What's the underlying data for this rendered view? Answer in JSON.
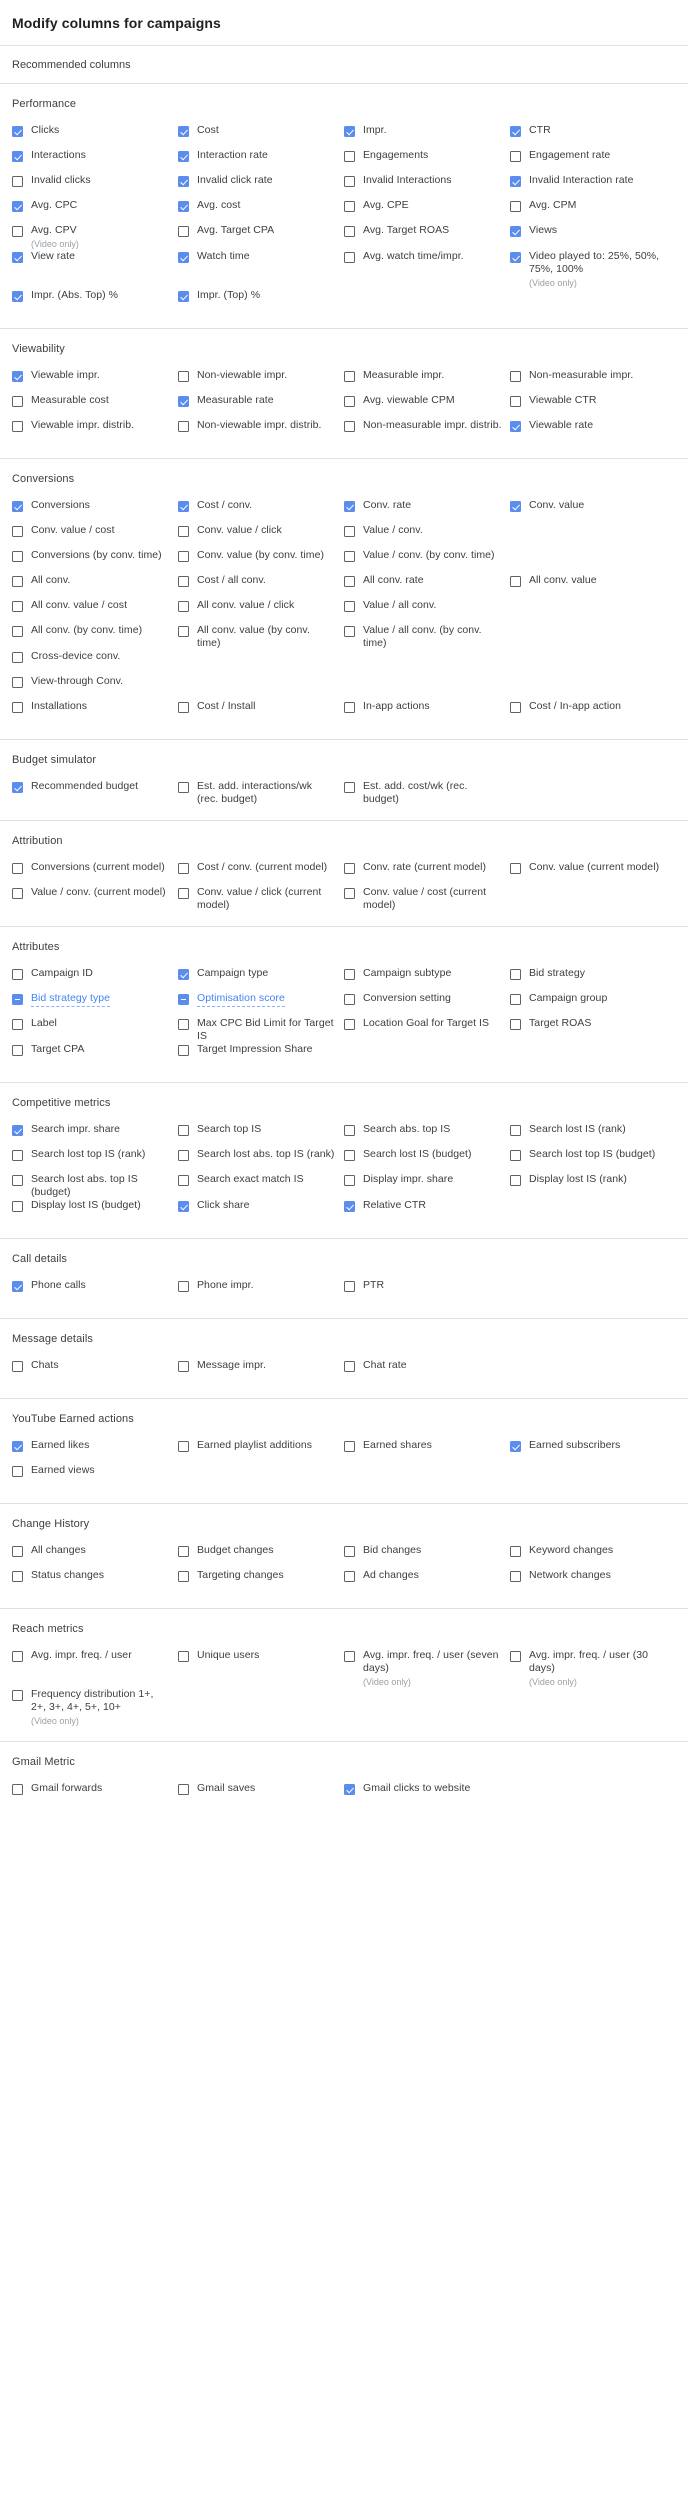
{
  "dialog": {
    "title": "Modify columns for campaigns",
    "recommended_label": "Recommended columns"
  },
  "colors": {
    "checkbox_checked": "#5b8def",
    "indeterminate_label": "#4285f4",
    "text": "#3c4043",
    "subtext": "#9aa0a6",
    "divider": "#e0e0e0"
  },
  "video_only_note": "(Video only)",
  "sections": [
    {
      "id": "performance",
      "title": "Performance",
      "rows": [
        [
          {
            "label": "Clicks",
            "state": "checked"
          },
          {
            "label": "Cost",
            "state": "checked"
          },
          {
            "label": "Impr.",
            "state": "checked"
          },
          {
            "label": "CTR",
            "state": "checked"
          }
        ],
        [
          {
            "label": "Interactions",
            "state": "checked"
          },
          {
            "label": "Interaction rate",
            "state": "checked"
          },
          {
            "label": "Engagements",
            "state": "unchecked"
          },
          {
            "label": "Engagement rate",
            "state": "unchecked"
          }
        ],
        [
          {
            "label": "Invalid clicks",
            "state": "unchecked"
          },
          {
            "label": "Invalid click rate",
            "state": "checked"
          },
          {
            "label": "Invalid Interactions",
            "state": "unchecked"
          },
          {
            "label": "Invalid Interaction rate",
            "state": "checked"
          }
        ],
        [
          {
            "label": "Avg. CPC",
            "state": "checked"
          },
          {
            "label": "Avg. cost",
            "state": "checked"
          },
          {
            "label": "Avg. CPE",
            "state": "unchecked"
          },
          {
            "label": "Avg. CPM",
            "state": "unchecked"
          }
        ],
        [
          {
            "label": "Avg. CPV",
            "state": "unchecked",
            "note": "(Video only)"
          },
          {
            "label": "Avg. Target CPA",
            "state": "unchecked"
          },
          {
            "label": "Avg. Target ROAS",
            "state": "unchecked"
          },
          {
            "label": "Views",
            "state": "checked"
          }
        ],
        [
          {
            "label": "View rate",
            "state": "checked"
          },
          {
            "label": "Watch time",
            "state": "checked"
          },
          {
            "label": "Avg. watch time/impr.",
            "state": "unchecked"
          },
          {
            "label": "Video played to: 25%, 50%, 75%, 100%",
            "state": "checked",
            "note": "(Video only)"
          }
        ],
        [
          {
            "label": "Impr. (Abs. Top) %",
            "state": "checked"
          },
          {
            "label": "Impr. (Top) %",
            "state": "checked"
          }
        ]
      ]
    },
    {
      "id": "viewability",
      "title": "Viewability",
      "rows": [
        [
          {
            "label": "Viewable impr.",
            "state": "checked"
          },
          {
            "label": "Non-viewable impr.",
            "state": "unchecked"
          },
          {
            "label": "Measurable impr.",
            "state": "unchecked"
          },
          {
            "label": "Non-measurable impr.",
            "state": "unchecked"
          }
        ],
        [
          {
            "label": "Measurable cost",
            "state": "unchecked"
          },
          {
            "label": "Measurable rate",
            "state": "checked"
          },
          {
            "label": "Avg. viewable CPM",
            "state": "unchecked"
          },
          {
            "label": "Viewable CTR",
            "state": "unchecked"
          }
        ],
        [
          {
            "label": "Viewable impr. distrib.",
            "state": "unchecked"
          },
          {
            "label": "Non-viewable impr. distrib.",
            "state": "unchecked"
          },
          {
            "label": "Non-measurable impr. distrib.",
            "state": "unchecked"
          },
          {
            "label": "Viewable rate",
            "state": "checked"
          }
        ]
      ]
    },
    {
      "id": "conversions",
      "title": "Conversions",
      "rows": [
        [
          {
            "label": "Conversions",
            "state": "checked"
          },
          {
            "label": "Cost / conv.",
            "state": "checked"
          },
          {
            "label": "Conv. rate",
            "state": "checked"
          },
          {
            "label": "Conv. value",
            "state": "checked"
          }
        ],
        [
          {
            "label": "Conv. value / cost",
            "state": "unchecked"
          },
          {
            "label": "Conv. value / click",
            "state": "unchecked"
          },
          {
            "label": "Value / conv.",
            "state": "unchecked"
          }
        ],
        [
          {
            "label": "Conversions (by conv. time)",
            "state": "unchecked"
          },
          {
            "label": "Conv. value (by conv. time)",
            "state": "unchecked"
          },
          {
            "label": "Value / conv. (by conv. time)",
            "state": "unchecked"
          }
        ],
        [
          {
            "label": "All conv.",
            "state": "unchecked"
          },
          {
            "label": "Cost / all conv.",
            "state": "unchecked"
          },
          {
            "label": "All conv. rate",
            "state": "unchecked"
          },
          {
            "label": "All conv. value",
            "state": "unchecked"
          }
        ],
        [
          {
            "label": "All conv. value / cost",
            "state": "unchecked"
          },
          {
            "label": "All conv. value / click",
            "state": "unchecked"
          },
          {
            "label": "Value / all conv.",
            "state": "unchecked"
          }
        ],
        [
          {
            "label": "All conv. (by conv. time)",
            "state": "unchecked"
          },
          {
            "label": "All conv. value (by conv. time)",
            "state": "unchecked"
          },
          {
            "label": "Value / all conv. (by conv. time)",
            "state": "unchecked"
          }
        ],
        [
          {
            "label": "Cross-device conv.",
            "state": "unchecked"
          }
        ],
        [
          {
            "label": "View-through Conv.",
            "state": "unchecked"
          }
        ],
        [
          {
            "label": "Installations",
            "state": "unchecked"
          },
          {
            "label": "Cost / Install",
            "state": "unchecked"
          },
          {
            "label": "In-app actions",
            "state": "unchecked"
          },
          {
            "label": "Cost / In-app action",
            "state": "unchecked"
          }
        ]
      ]
    },
    {
      "id": "budget-simulator",
      "title": "Budget simulator",
      "rows": [
        [
          {
            "label": "Recommended budget",
            "state": "checked"
          },
          {
            "label": "Est. add. interactions/wk (rec. budget)",
            "state": "unchecked"
          },
          {
            "label": "Est. add. cost/wk (rec. budget)",
            "state": "unchecked"
          }
        ]
      ]
    },
    {
      "id": "attribution",
      "title": "Attribution",
      "rows": [
        [
          {
            "label": "Conversions (current model)",
            "state": "unchecked"
          },
          {
            "label": "Cost / conv. (current model)",
            "state": "unchecked"
          },
          {
            "label": "Conv. rate (current model)",
            "state": "unchecked"
          },
          {
            "label": "Conv. value (current model)",
            "state": "unchecked"
          }
        ],
        [
          {
            "label": "Value / conv. (current model)",
            "state": "unchecked"
          },
          {
            "label": "Conv. value / click (current model)",
            "state": "unchecked"
          },
          {
            "label": "Conv. value / cost (current model)",
            "state": "unchecked"
          }
        ]
      ]
    },
    {
      "id": "attributes",
      "title": "Attributes",
      "rows": [
        [
          {
            "label": "Campaign ID",
            "state": "unchecked"
          },
          {
            "label": "Campaign type",
            "state": "checked"
          },
          {
            "label": "Campaign subtype",
            "state": "unchecked"
          },
          {
            "label": "Bid strategy",
            "state": "unchecked"
          }
        ],
        [
          {
            "label": "Bid strategy type",
            "state": "indeterminate",
            "emphasis": true
          },
          {
            "label": "Optimisation score",
            "state": "indeterminate",
            "emphasis": true
          },
          {
            "label": "Conversion setting",
            "state": "unchecked"
          },
          {
            "label": "Campaign group",
            "state": "unchecked"
          }
        ],
        [
          {
            "label": "Label",
            "state": "unchecked"
          },
          {
            "label": "Max CPC Bid Limit for Target IS",
            "state": "unchecked"
          },
          {
            "label": "Location Goal for Target IS",
            "state": "unchecked"
          },
          {
            "label": "Target ROAS",
            "state": "unchecked"
          }
        ],
        [
          {
            "label": "Target CPA",
            "state": "unchecked"
          },
          {
            "label": "Target Impression Share",
            "state": "unchecked"
          }
        ]
      ]
    },
    {
      "id": "competitive-metrics",
      "title": "Competitive metrics",
      "rows": [
        [
          {
            "label": "Search impr. share",
            "state": "checked"
          },
          {
            "label": "Search top IS",
            "state": "unchecked"
          },
          {
            "label": "Search abs. top IS",
            "state": "unchecked"
          },
          {
            "label": "Search lost IS (rank)",
            "state": "unchecked"
          }
        ],
        [
          {
            "label": "Search lost top IS (rank)",
            "state": "unchecked"
          },
          {
            "label": "Search lost abs. top IS (rank)",
            "state": "unchecked"
          },
          {
            "label": "Search lost IS (budget)",
            "state": "unchecked"
          },
          {
            "label": "Search lost top IS (budget)",
            "state": "unchecked"
          }
        ],
        [
          {
            "label": "Search lost abs. top IS (budget)",
            "state": "unchecked"
          },
          {
            "label": "Search exact match IS",
            "state": "unchecked"
          },
          {
            "label": "Display impr. share",
            "state": "unchecked"
          },
          {
            "label": "Display lost IS (rank)",
            "state": "unchecked"
          }
        ],
        [
          {
            "label": "Display lost IS (budget)",
            "state": "unchecked"
          },
          {
            "label": "Click share",
            "state": "checked"
          },
          {
            "label": "Relative CTR",
            "state": "checked"
          }
        ]
      ]
    },
    {
      "id": "call-details",
      "title": "Call details",
      "rows": [
        [
          {
            "label": "Phone calls",
            "state": "checked"
          },
          {
            "label": "Phone impr.",
            "state": "unchecked"
          },
          {
            "label": "PTR",
            "state": "unchecked"
          }
        ]
      ]
    },
    {
      "id": "message-details",
      "title": "Message details",
      "rows": [
        [
          {
            "label": "Chats",
            "state": "unchecked"
          },
          {
            "label": "Message impr.",
            "state": "unchecked"
          },
          {
            "label": "Chat rate",
            "state": "unchecked"
          }
        ]
      ]
    },
    {
      "id": "youtube-earned-actions",
      "title": "YouTube Earned actions",
      "rows": [
        [
          {
            "label": "Earned likes",
            "state": "checked"
          },
          {
            "label": "Earned playlist additions",
            "state": "unchecked"
          },
          {
            "label": "Earned shares",
            "state": "unchecked"
          },
          {
            "label": "Earned subscribers",
            "state": "checked"
          }
        ],
        [
          {
            "label": "Earned views",
            "state": "unchecked"
          }
        ]
      ]
    },
    {
      "id": "change-history",
      "title": "Change History",
      "rows": [
        [
          {
            "label": "All changes",
            "state": "unchecked"
          },
          {
            "label": "Budget changes",
            "state": "unchecked"
          },
          {
            "label": "Bid changes",
            "state": "unchecked"
          },
          {
            "label": "Keyword changes",
            "state": "unchecked"
          }
        ],
        [
          {
            "label": "Status changes",
            "state": "unchecked"
          },
          {
            "label": "Targeting changes",
            "state": "unchecked"
          },
          {
            "label": "Ad changes",
            "state": "unchecked"
          },
          {
            "label": "Network changes",
            "state": "unchecked"
          }
        ]
      ]
    },
    {
      "id": "reach-metrics",
      "title": "Reach metrics",
      "rows": [
        [
          {
            "label": "Avg. impr. freq. / user",
            "state": "unchecked"
          },
          {
            "label": "Unique users",
            "state": "unchecked"
          },
          {
            "label": "Avg. impr. freq. / user (seven days)",
            "state": "unchecked",
            "note": "(Video only)"
          },
          {
            "label": "Avg. impr. freq. / user (30 days)",
            "state": "unchecked",
            "note": "(Video only)"
          }
        ],
        [
          {
            "label": "Frequency distribution 1+, 2+, 3+, 4+, 5+, 10+",
            "state": "unchecked",
            "note": "(Video only)"
          }
        ]
      ]
    },
    {
      "id": "gmail-metric",
      "title": "Gmail Metric",
      "rows": [
        [
          {
            "label": "Gmail forwards",
            "state": "unchecked"
          },
          {
            "label": "Gmail saves",
            "state": "unchecked"
          },
          {
            "label": "Gmail clicks to website",
            "state": "checked"
          }
        ]
      ]
    }
  ]
}
